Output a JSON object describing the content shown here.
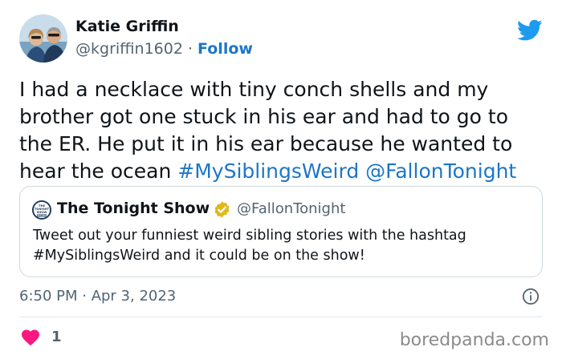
{
  "author": {
    "name": "Katie Griffin",
    "handle": "@kgriffin1602",
    "separator": " · ",
    "follow_label": "Follow"
  },
  "tweet": {
    "text": "I had a necklace with tiny conch shells and my brother got one stuck in his ear and had to go to the ER. He put it in his ear because he wanted to hear the ocean ",
    "hashtag": "#MySiblingsWeird",
    "mention": "@FallonTonight",
    "timestamp": "6:50 PM · Apr 3, 2023",
    "like_count": "1"
  },
  "quoted_tweet": {
    "name": "The Tonight Show",
    "handle": "@FallonTonight",
    "logo_text": "THE TONIGHT SHOW FALLON",
    "text": "Tweet out your funniest weird sibling stories with the hashtag #MySiblingsWeird and it could be on the show!"
  },
  "watermark": "boredpanda.com",
  "icons": {
    "brand": "twitter-bird-icon",
    "verified": "gold-verified-badge-icon",
    "info": "info-icon",
    "like": "heart-icon"
  },
  "colors": {
    "link": "#1d76c8",
    "twitter_blue": "#1d9bf0",
    "heart": "#f91880",
    "verified_gold": "#e2b719",
    "secondary_text": "#536471"
  }
}
